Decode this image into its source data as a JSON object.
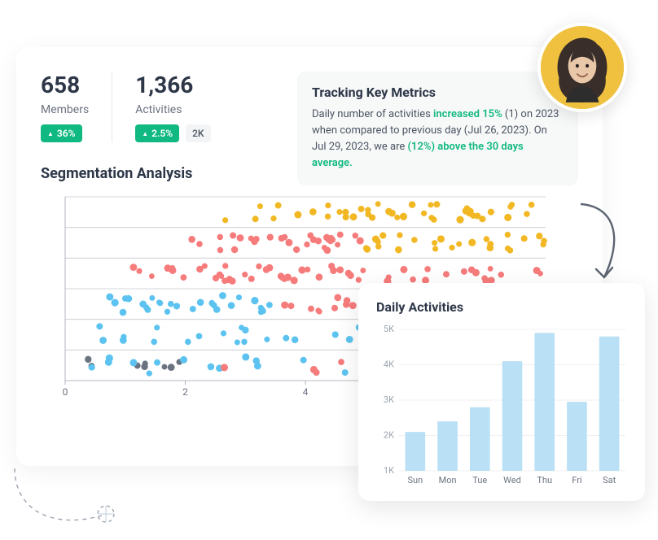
{
  "stats": {
    "members": {
      "value": "658",
      "label": "Members",
      "delta": "36%"
    },
    "activities": {
      "value": "1,366",
      "label": "Activities",
      "delta": "2.5%",
      "extra": "2K"
    }
  },
  "insight": {
    "title": "Tracking Key Metrics",
    "t1": "Daily number of activities ",
    "h1": "increased 15%",
    "t2": " (1) on 2023 when compared to previous day (Jul 26, 2023). On Jul 29, 2023, we are ",
    "h2": "(12%) above the 30 days average."
  },
  "segmentation": {
    "title": "Segmentation Analysis"
  },
  "daily": {
    "title": "Daily Activities"
  },
  "chart_data": [
    {
      "type": "scatter",
      "title": "Segmentation Analysis",
      "xlabel": "",
      "ylabel": "",
      "xlim": [
        0,
        8
      ],
      "x_ticks": [
        0,
        2,
        4,
        6,
        8
      ],
      "rows": 6,
      "colors": {
        "yellow": "#f2b824",
        "red": "#f67b7b",
        "blue": "#5cc3f0",
        "gray": "#6b7280"
      },
      "note": "Dense jittered dot-strip plot; each row is a segment. Row 0 (top) mostly yellow ~2.5–8; Row 1 red ~1.7–5 with yellow ~5–8; Row 2 red ~1–8; Row 3 blue ~0.5–3.5, red ~3.5–8; Row 4 blue ~0–6 sparse; Row 5 mixed blue/red/gray sparse ~0–6."
    },
    {
      "type": "bar",
      "title": "Daily Activities",
      "categories": [
        "Sun",
        "Mon",
        "Tue",
        "Wed",
        "Thu",
        "Fri",
        "Sat"
      ],
      "values": [
        2100,
        2400,
        2800,
        4100,
        4900,
        2950,
        4800
      ],
      "ylabel": "",
      "ylim": [
        1000,
        5000
      ],
      "y_ticks": [
        1000,
        2000,
        3000,
        4000,
        5000
      ],
      "y_tick_labels": [
        "1K",
        "2K",
        "3K",
        "4K",
        "5K"
      ]
    }
  ]
}
